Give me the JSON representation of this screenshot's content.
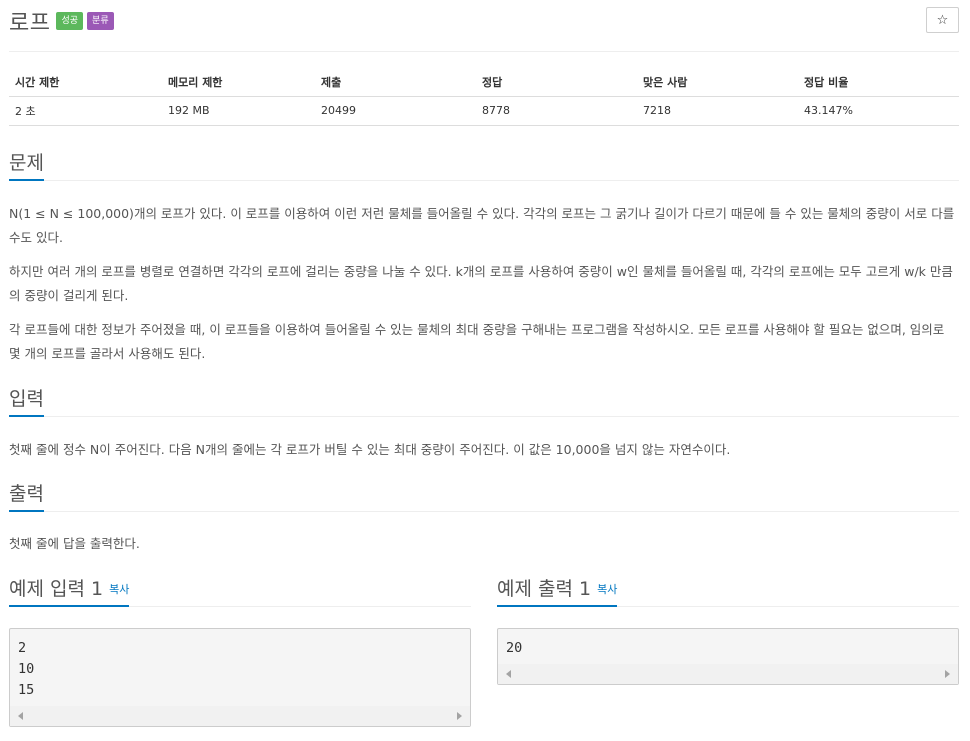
{
  "problem": {
    "title": "로프",
    "badges": {
      "success": "성공",
      "category": "분류"
    },
    "star_icon": "☆"
  },
  "stats": {
    "headers": [
      "시간 제한",
      "메모리 제한",
      "제출",
      "정답",
      "맞은 사람",
      "정답 비율"
    ],
    "values": [
      "2 초",
      "192 MB",
      "20499",
      "8778",
      "7218",
      "43.147%"
    ]
  },
  "description": {
    "heading": "문제",
    "paragraphs": [
      "N(1 ≤ N ≤ 100,000)개의 로프가 있다. 이 로프를 이용하여 이런 저런 물체를 들어올릴 수 있다. 각각의 로프는 그 굵기나 길이가 다르기 때문에 들 수 있는 물체의 중량이 서로 다를 수도 있다.",
      "하지만 여러 개의 로프를 병렬로 연결하면 각각의 로프에 걸리는 중량을 나눌 수 있다. k개의 로프를 사용하여 중량이 w인 물체를 들어올릴 때, 각각의 로프에는 모두 고르게 w/k 만큼의 중량이 걸리게 된다.",
      "각 로프들에 대한 정보가 주어졌을 때, 이 로프들을 이용하여 들어올릴 수 있는 물체의 최대 중량을 구해내는 프로그램을 작성하시오. 모든 로프를 사용해야 할 필요는 없으며, 임의로 몇 개의 로프를 골라서 사용해도 된다."
    ]
  },
  "input": {
    "heading": "입력",
    "text": "첫째 줄에 정수 N이 주어진다. 다음 N개의 줄에는 각 로프가 버틸 수 있는 최대 중량이 주어진다. 이 값은 10,000을 넘지 않는 자연수이다."
  },
  "output": {
    "heading": "출력",
    "text": "첫째 줄에 답을 출력한다."
  },
  "samples": {
    "input_title": "예제 입력 1",
    "output_title": "예제 출력 1",
    "copy_label": "복사",
    "input_data": "2\n10\n15",
    "output_data": "20"
  }
}
